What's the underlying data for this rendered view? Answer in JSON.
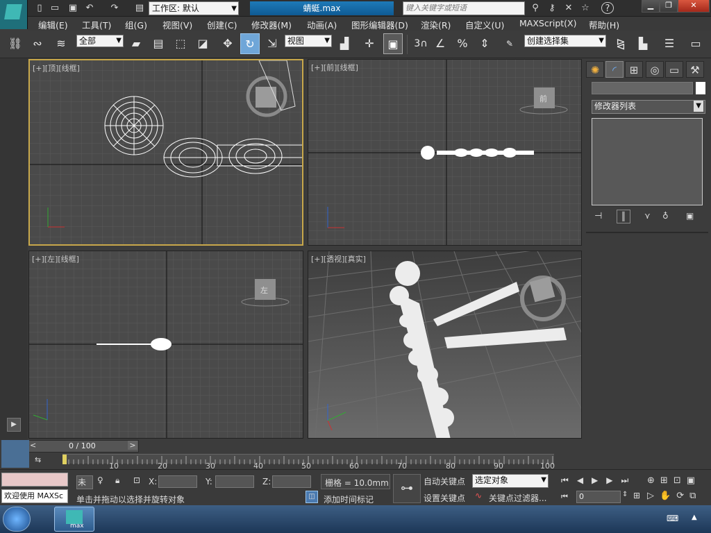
{
  "app": {
    "workspace_label": "工作区: 默认",
    "title": "蜻蜓.max",
    "search_placeholder": "键入关键字或短语",
    "help_symbol": "?"
  },
  "menus": [
    "编辑(E)",
    "工具(T)",
    "组(G)",
    "视图(V)",
    "创建(C)",
    "修改器(M)",
    "动画(A)",
    "图形编辑器(D)",
    "渲染(R)",
    "自定义(U)",
    "MAXScript(X)",
    "帮助(H)"
  ],
  "toolbar": {
    "selection_filter": "全部",
    "ref_coord": "视图",
    "named_selection": "创建选择集",
    "snap_3_label": "3"
  },
  "viewports": {
    "top": "[+][顶][线框]",
    "front": "[+][前][线框]",
    "left": "[+][左][线框]",
    "persp": "[+][透视][真实]",
    "viewcube_front": "前",
    "viewcube_left": "左"
  },
  "command_panel": {
    "modifier_list": "修改器列表"
  },
  "timeline": {
    "frame_counter": "0 / 100",
    "ticks": [
      "10",
      "20",
      "30",
      "40",
      "50",
      "60",
      "70",
      "80",
      "90",
      "100"
    ],
    "slider_value_frac": 0.0
  },
  "status": {
    "maxscript_label": "欢迎使用 MAXSc",
    "not_selected": "未选",
    "x_label": "X:",
    "y_label": "Y:",
    "z_label": "Z:",
    "grid": "栅格 = 10.0mm",
    "auto_key": "自动关键点",
    "set_key": "设置关键点",
    "selected_obj": "选定对象",
    "key_filter": "关键点过滤器...",
    "prompt": "单击并拖动以选择并旋转对象",
    "add_time_tag": "添加时间标记",
    "frame_field": "0"
  },
  "taskbar": {
    "app_label": "max"
  },
  "colors": {
    "accent": "#6fa6d8",
    "active_viewport_border": "#c8a84a",
    "viewport_bg": "#4a4a4a",
    "persp_bg": "#5b5b5b"
  }
}
